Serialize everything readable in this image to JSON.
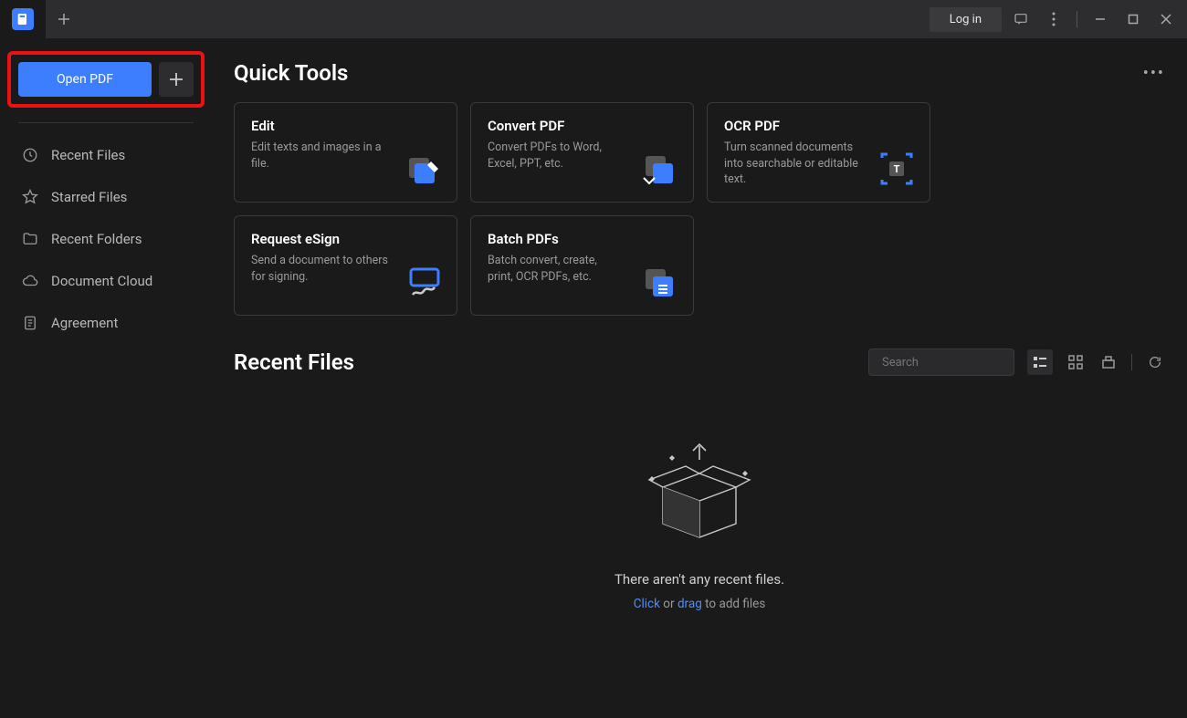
{
  "titlebar": {
    "login_label": "Log in"
  },
  "sidebar": {
    "open_pdf_label": "Open PDF",
    "items": [
      {
        "label": "Recent Files"
      },
      {
        "label": "Starred Files"
      },
      {
        "label": "Recent Folders"
      },
      {
        "label": "Document Cloud"
      },
      {
        "label": "Agreement"
      }
    ]
  },
  "quick_tools": {
    "title": "Quick Tools",
    "cards": [
      {
        "title": "Edit",
        "desc": "Edit texts and images in a file."
      },
      {
        "title": "Convert PDF",
        "desc": "Convert PDFs to Word, Excel, PPT, etc."
      },
      {
        "title": "OCR PDF",
        "desc": "Turn scanned documents into searchable or editable text."
      },
      {
        "title": "Request eSign",
        "desc": "Send a document to others for signing."
      },
      {
        "title": "Batch PDFs",
        "desc": "Batch convert, create, print, OCR PDFs, etc."
      }
    ]
  },
  "recent": {
    "title": "Recent Files",
    "search_placeholder": "Search",
    "empty_text": "There aren't any recent files.",
    "empty_sub_click": "Click",
    "empty_sub_or": " or ",
    "empty_sub_drag": "drag",
    "empty_sub_tail": " to add files"
  }
}
